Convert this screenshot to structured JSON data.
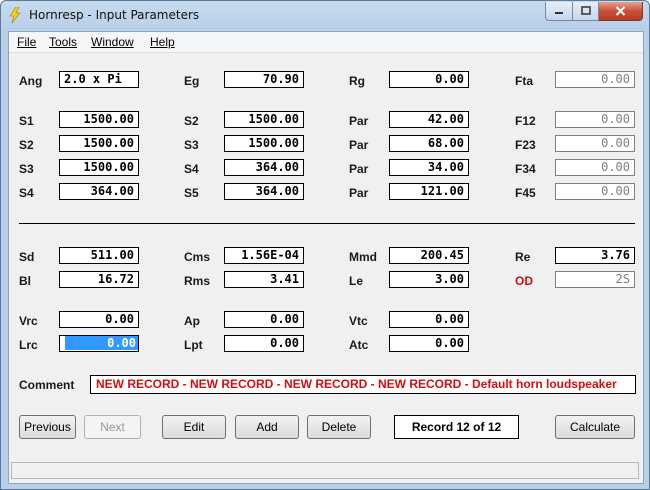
{
  "window": {
    "title": "Hornresp - Input Parameters"
  },
  "menu": [
    "File",
    "Tools",
    "Window",
    "Help"
  ],
  "rows_top": [
    [
      {
        "label": "Ang",
        "value": "2.0 x Pi",
        "type": "ang"
      },
      {
        "label": "Eg",
        "value": "70.90"
      },
      {
        "label": "Rg",
        "value": "0.00"
      },
      {
        "label": "Fta",
        "value": "0.00",
        "disabled": true
      }
    ],
    [
      {
        "label": "S1",
        "value": "1500.00"
      },
      {
        "label": "S2",
        "value": "1500.00"
      },
      {
        "label": "Par",
        "value": "42.00"
      },
      {
        "label": "F12",
        "value": "0.00",
        "disabled": true
      }
    ],
    [
      {
        "label": "S2",
        "value": "1500.00"
      },
      {
        "label": "S3",
        "value": "1500.00"
      },
      {
        "label": "Par",
        "value": "68.00"
      },
      {
        "label": "F23",
        "value": "0.00",
        "disabled": true
      }
    ],
    [
      {
        "label": "S3",
        "value": "1500.00"
      },
      {
        "label": "S4",
        "value": "364.00"
      },
      {
        "label": "Par",
        "value": "34.00"
      },
      {
        "label": "F34",
        "value": "0.00",
        "disabled": true
      }
    ],
    [
      {
        "label": "S4",
        "value": "364.00"
      },
      {
        "label": "S5",
        "value": "364.00"
      },
      {
        "label": "Par",
        "value": "121.00"
      },
      {
        "label": "F45",
        "value": "0.00",
        "disabled": true
      }
    ]
  ],
  "rows_bottom": [
    [
      {
        "label": "Sd",
        "value": "511.00"
      },
      {
        "label": "Cms",
        "value": "1.56E-04"
      },
      {
        "label": "Mmd",
        "value": "200.45"
      },
      {
        "label": "Re",
        "value": "3.76"
      }
    ],
    [
      {
        "label": "Bl",
        "value": "16.72"
      },
      {
        "label": "Rms",
        "value": "3.41"
      },
      {
        "label": "Le",
        "value": "3.00"
      },
      {
        "label": "OD",
        "value": "2S",
        "red": true,
        "disabled": true
      }
    ],
    [
      {
        "label": "Vrc",
        "value": "0.00"
      },
      {
        "label": "Ap",
        "value": "0.00"
      },
      {
        "label": "Vtc",
        "value": "0.00"
      }
    ],
    [
      {
        "label": "Lrc",
        "value": "0.00",
        "selected": true
      },
      {
        "label": "Lpt",
        "value": "0.00"
      },
      {
        "label": "Atc",
        "value": "0.00"
      }
    ]
  ],
  "comment": {
    "label": "Comment",
    "value": "NEW RECORD - NEW RECORD - NEW RECORD - NEW RECORD - Default horn loudspeaker"
  },
  "buttons": {
    "previous": "Previous",
    "next": "Next",
    "edit": "Edit",
    "add": "Add",
    "delete": "Delete",
    "calculate": "Calculate"
  },
  "record_indicator": "Record 12 of 12",
  "status": ""
}
